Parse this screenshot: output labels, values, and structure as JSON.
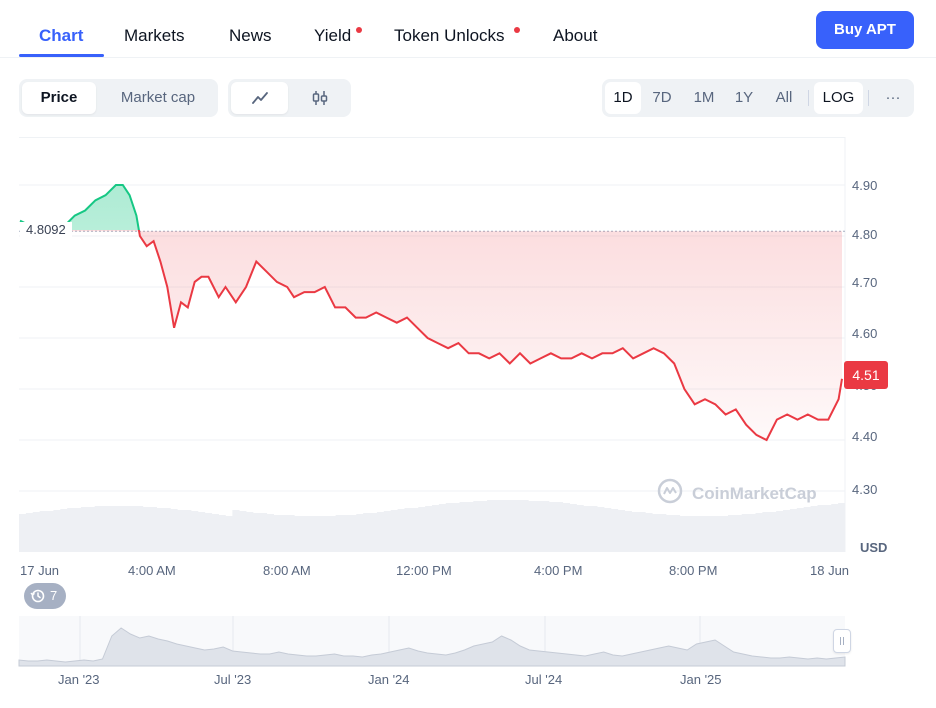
{
  "tabs": [
    {
      "label": "Chart",
      "active": true
    },
    {
      "label": "Markets"
    },
    {
      "label": "News"
    },
    {
      "label": "Yield",
      "dot": true
    },
    {
      "label": "Token Unlocks",
      "dot": true
    },
    {
      "label": "About"
    }
  ],
  "buy_button": "Buy APT",
  "view_toggle": [
    "Price",
    "Market cap"
  ],
  "chart_type_icons": [
    "line-chart-icon",
    "candlestick-icon"
  ],
  "timeframes": [
    "1D",
    "7D",
    "1M",
    "1Y",
    "All"
  ],
  "log_label": "LOG",
  "more_label": "···",
  "chart_data": {
    "type": "line",
    "unit": "USD",
    "reference_price": "4.8092",
    "current_price": "4.51",
    "yticks": [
      "4.90",
      "4.80",
      "4.70",
      "4.60",
      "4.50",
      "4.40",
      "4.30"
    ],
    "xticks": [
      "17 Jun",
      "4:00 AM",
      "8:00 AM",
      "12:00 PM",
      "4:00 PM",
      "8:00 PM",
      "18 Jun"
    ],
    "ylim": [
      4.2,
      5.0
    ],
    "x_hours": [
      0,
      0.3,
      0.6,
      1,
      1.3,
      1.6,
      1.9,
      2.2,
      2.5,
      2.8,
      3,
      3.2,
      3.4,
      3.5,
      3.7,
      3.9,
      4.1,
      4.3,
      4.5,
      4.7,
      4.9,
      5.1,
      5.3,
      5.5,
      5.8,
      6,
      6.3,
      6.6,
      6.9,
      7.2,
      7.5,
      7.8,
      8,
      8.3,
      8.6,
      8.9,
      9.2,
      9.5,
      9.8,
      10.1,
      10.4,
      10.7,
      11,
      11.3,
      11.6,
      11.9,
      12.2,
      12.5,
      12.8,
      13.1,
      13.4,
      13.7,
      14,
      14.3,
      14.6,
      14.9,
      15.2,
      15.5,
      15.8,
      16.1,
      16.4,
      16.7,
      17,
      17.3,
      17.6,
      17.9,
      18.2,
      18.5,
      18.8,
      19.1,
      19.4,
      19.7,
      20,
      20.3,
      20.6,
      20.9,
      21.2,
      21.5,
      21.8,
      22.1,
      22.4,
      22.7,
      23,
      23.3,
      23.6,
      23.9,
      24
    ],
    "prices": [
      4.83,
      4.82,
      4.81,
      4.81,
      4.82,
      4.84,
      4.85,
      4.87,
      4.88,
      4.9,
      4.9,
      4.88,
      4.84,
      4.8,
      4.78,
      4.79,
      4.75,
      4.7,
      4.62,
      4.67,
      4.66,
      4.71,
      4.72,
      4.72,
      4.68,
      4.7,
      4.67,
      4.7,
      4.75,
      4.73,
      4.71,
      4.7,
      4.68,
      4.69,
      4.69,
      4.7,
      4.66,
      4.66,
      4.64,
      4.64,
      4.65,
      4.64,
      4.63,
      4.64,
      4.62,
      4.6,
      4.59,
      4.58,
      4.59,
      4.57,
      4.57,
      4.56,
      4.57,
      4.55,
      4.57,
      4.55,
      4.56,
      4.57,
      4.56,
      4.56,
      4.57,
      4.56,
      4.57,
      4.57,
      4.58,
      4.56,
      4.57,
      4.58,
      4.57,
      4.55,
      4.5,
      4.47,
      4.48,
      4.47,
      4.45,
      4.46,
      4.43,
      4.41,
      4.4,
      4.44,
      4.45,
      4.44,
      4.45,
      4.44,
      4.44,
      4.48,
      4.52
    ]
  },
  "navigator": {
    "history_count": "7",
    "labels": [
      "Jan '23",
      "Jul '23",
      "Jan '24",
      "Jul '24",
      "Jan '25"
    ]
  },
  "watermark": "CoinMarketCap",
  "colors": {
    "accent": "#3861fb",
    "up": "#16c784",
    "down": "#ea3943"
  }
}
